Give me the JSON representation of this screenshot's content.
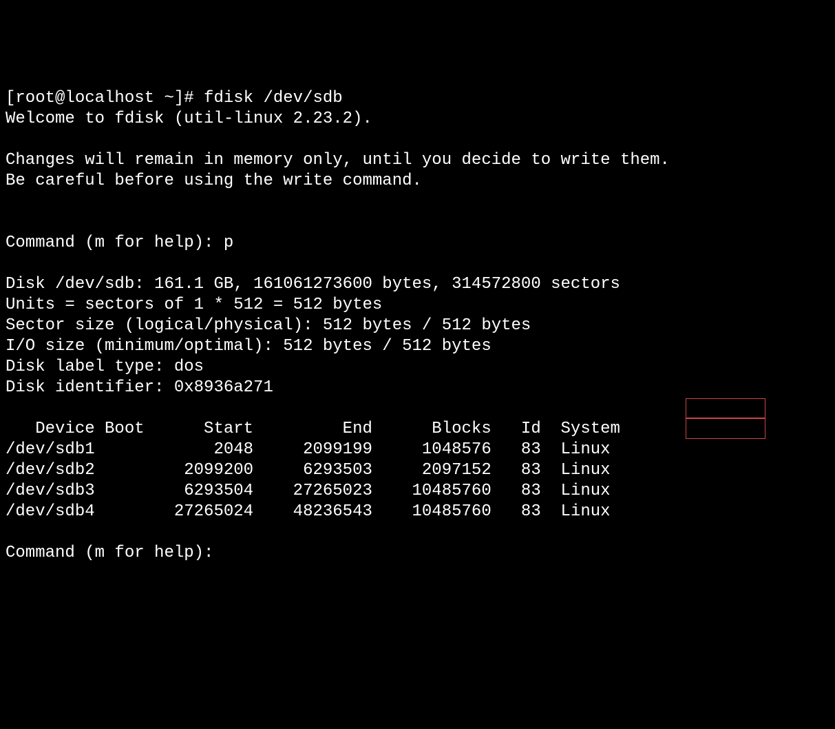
{
  "prompt1": "[root@localhost ~]# ",
  "command1": "fdisk /dev/sdb",
  "welcome": "Welcome to fdisk (util-linux 2.23.2).",
  "warning1": "Changes will remain in memory only, until you decide to write them.",
  "warning2": "Be careful before using the write command.",
  "cmdPrompt1": "Command (m for help): ",
  "cmdInput1": "p",
  "diskInfo1": "Disk /dev/sdb: 161.1 GB, 161061273600 bytes, 314572800 sectors",
  "diskInfo2": "Units = sectors of 1 * 512 = 512 bytes",
  "diskInfo3": "Sector size (logical/physical): 512 bytes / 512 bytes",
  "diskInfo4": "I/O size (minimum/optimal): 512 bytes / 512 bytes",
  "diskInfo5": "Disk label type: dos",
  "diskInfo6": "Disk identifier: 0x8936a271",
  "tableHeader": "   Device Boot      Start         End      Blocks   Id  System",
  "tableRow1": "/dev/sdb1            2048     2099199     1048576   83  Linux",
  "tableRow2": "/dev/sdb2         2099200     6293503     2097152   83  Linux",
  "tableRow3": "/dev/sdb3         6293504    27265023    10485760   83  Linux",
  "tableRow4": "/dev/sdb4        27265024    48236543    10485760   83  Linux",
  "cmdPrompt2": "Command (m for help): ",
  "partitions": [
    {
      "device": "/dev/sdb1",
      "boot": "",
      "start": 2048,
      "end": 2099199,
      "blocks": 1048576,
      "id": "83",
      "system": "Linux"
    },
    {
      "device": "/dev/sdb2",
      "boot": "",
      "start": 2099200,
      "end": 6293503,
      "blocks": 2097152,
      "id": "83",
      "system": "Linux"
    },
    {
      "device": "/dev/sdb3",
      "boot": "",
      "start": 6293504,
      "end": 27265023,
      "blocks": 10485760,
      "id": "83",
      "system": "Linux"
    },
    {
      "device": "/dev/sdb4",
      "boot": "",
      "start": 27265024,
      "end": 48236543,
      "blocks": 10485760,
      "id": "83",
      "system": "Linux"
    }
  ]
}
